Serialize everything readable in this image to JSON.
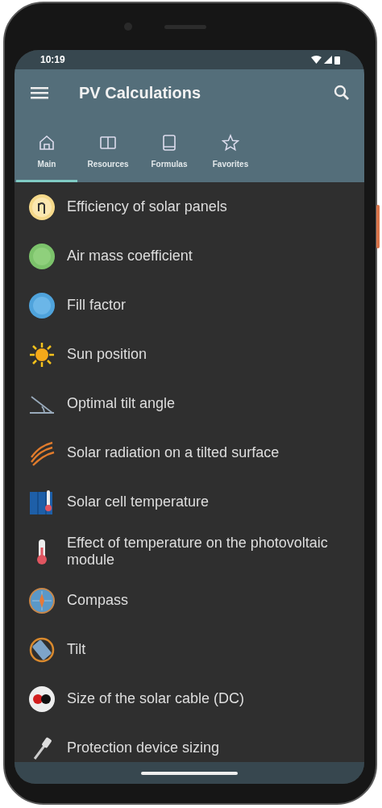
{
  "status_bar": {
    "time": "10:19"
  },
  "app_bar": {
    "title": "PV Calculations"
  },
  "tabs": [
    {
      "label": "Main",
      "kind": "home",
      "selected": true
    },
    {
      "label": "Resources",
      "kind": "book",
      "selected": false
    },
    {
      "label": "Formulas",
      "kind": "tablet",
      "selected": false
    },
    {
      "label": "Favorites",
      "kind": "star",
      "selected": false
    }
  ],
  "items": [
    {
      "label": "Efficiency of solar panels",
      "kind": "eta"
    },
    {
      "label": "Air mass coefficient",
      "kind": "airmass"
    },
    {
      "label": "Fill factor",
      "kind": "fill"
    },
    {
      "label": "Sun position",
      "kind": "sun"
    },
    {
      "label": "Optimal tilt angle",
      "kind": "angle"
    },
    {
      "label": "Solar radiation on a tilted surface",
      "kind": "radiation"
    },
    {
      "label": "Solar cell temperature",
      "kind": "panel"
    },
    {
      "label": "Effect of temperature on the photovoltaic module",
      "kind": "thermometer"
    },
    {
      "label": "Compass",
      "kind": "compass"
    },
    {
      "label": "Tilt",
      "kind": "tilt"
    },
    {
      "label": "Size of the solar cable (DC)",
      "kind": "cable"
    },
    {
      "label": "Protection device sizing",
      "kind": "tool"
    }
  ]
}
